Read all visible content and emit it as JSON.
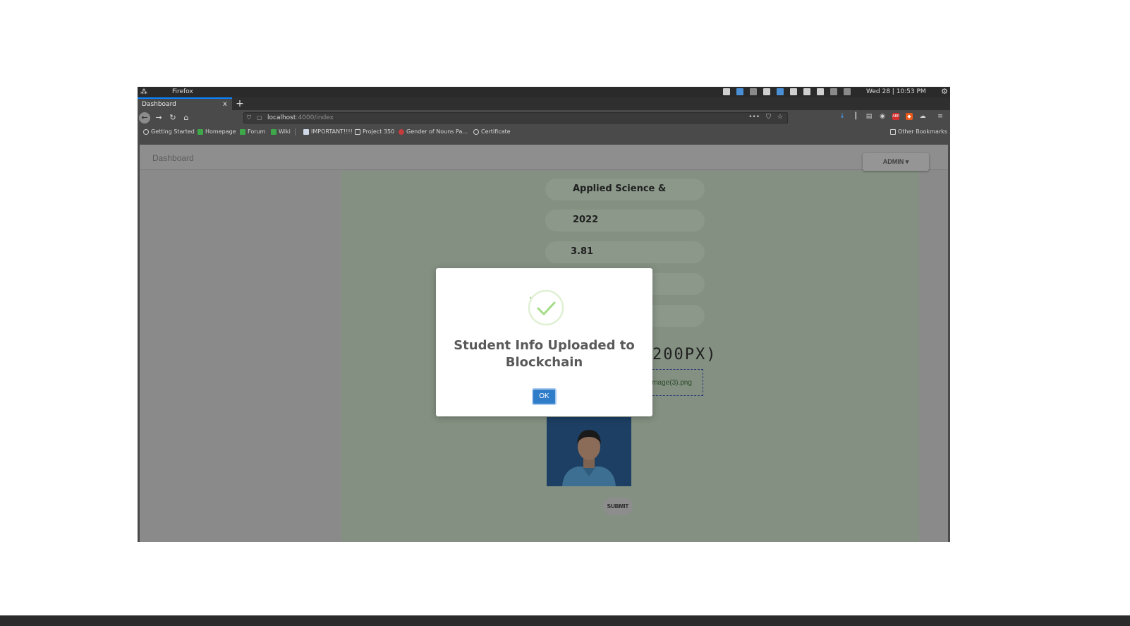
{
  "os_panel": {
    "app_name": "Firefox",
    "clock": "Wed 28 | 10:53 PM"
  },
  "browser": {
    "tab_title": "Dashboard",
    "tab_close": "x",
    "new_tab": "+",
    "url_host": "localhost",
    "url_path": ":4000/index",
    "url_actions": [
      "•••",
      "⛉",
      "☆"
    ],
    "bookmarks": [
      {
        "label": "Getting Started",
        "icon": "globe-icon"
      },
      {
        "label": "Homepage",
        "icon": "green-bookmark-icon"
      },
      {
        "label": "Forum",
        "icon": "green-bookmark-icon"
      },
      {
        "label": "Wiki",
        "icon": "green-bookmark-icon"
      },
      {
        "label": "IMPORTANT!!!!",
        "icon": "doc-icon"
      },
      {
        "label": "Project 350",
        "icon": "folder-icon"
      },
      {
        "label": "Gender of Nouns Pa...",
        "icon": "red-site-icon"
      },
      {
        "label": "Certificate",
        "icon": "globe-icon"
      }
    ],
    "other_bookmarks": "Other Bookmarks"
  },
  "page": {
    "title": "Dashboard",
    "admin_label": "ADMIN ▾",
    "fields": {
      "department": "Applied Science &",
      "year": "2022",
      "cgpa": "3.81"
    },
    "image_label_partial": "200PX)",
    "file_name": "image(3).png",
    "submit_label": "SUBMIT"
  },
  "modal": {
    "title": "Student Info Uploaded to Blockchain",
    "ok_label": "OK"
  },
  "colors": {
    "accent": "#2f7cc9",
    "success": "#a5dc86",
    "tab_highlight": "#0a84ff"
  }
}
